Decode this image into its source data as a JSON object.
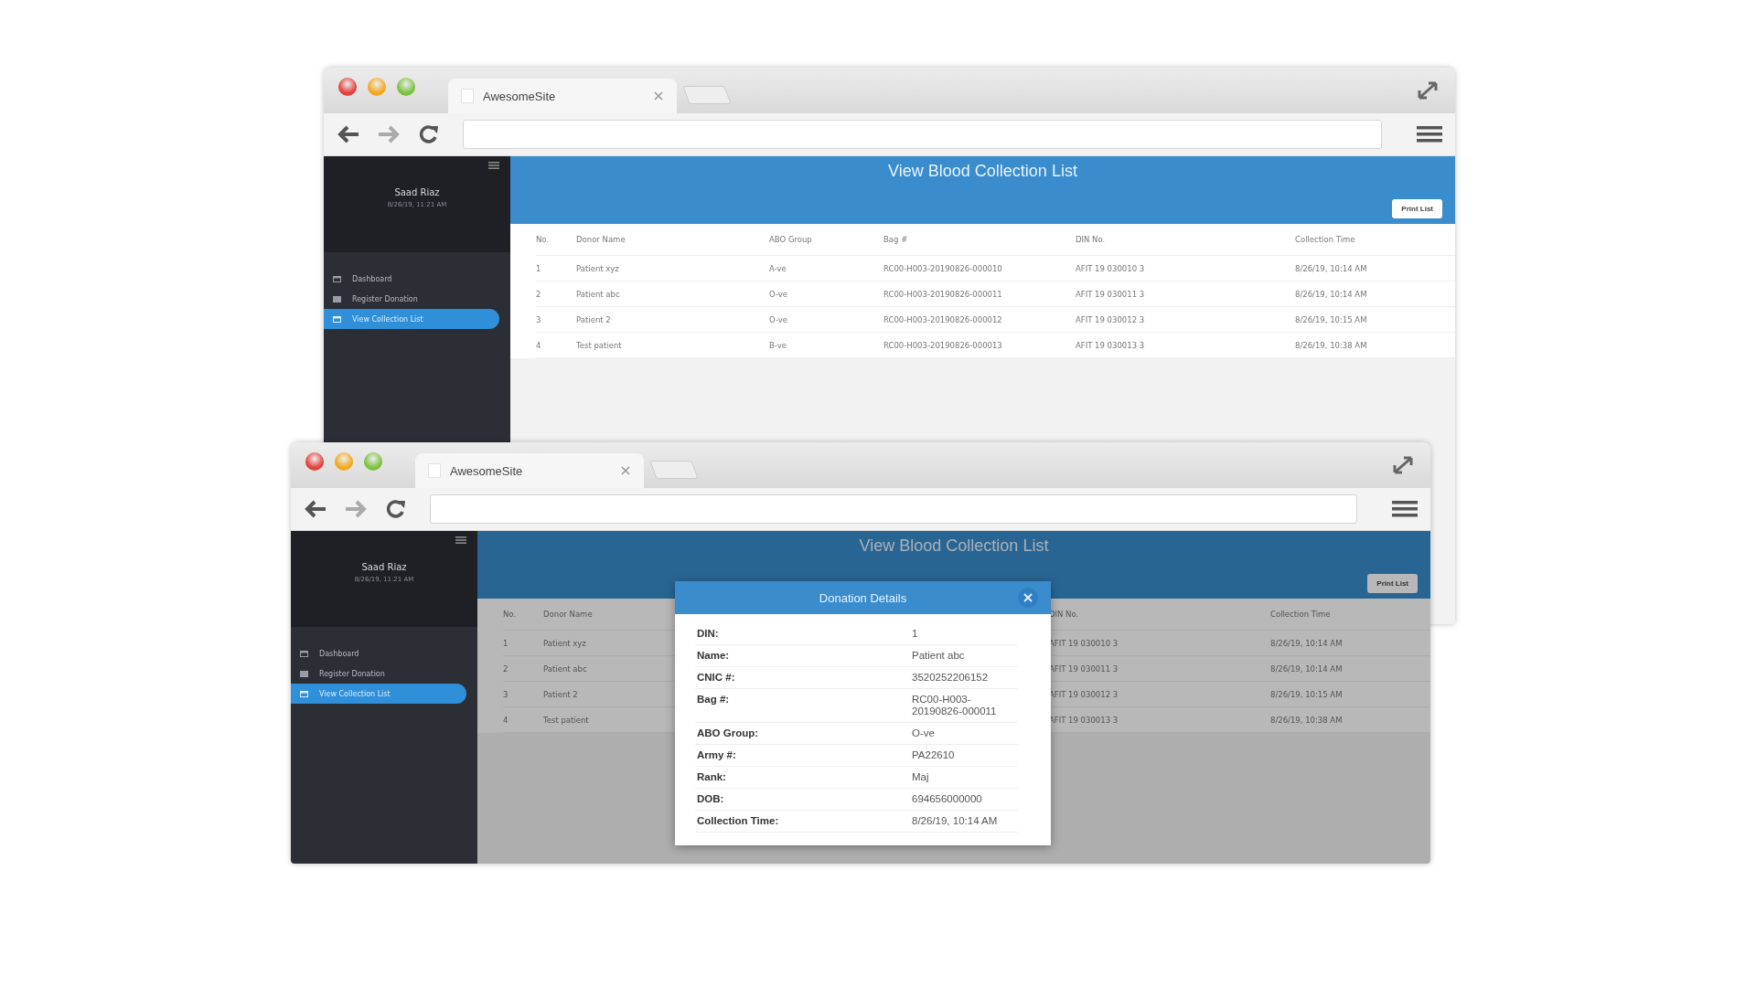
{
  "windows": [
    {
      "tab_title": "AwesomeSite",
      "page_title": "View Blood Collection List",
      "print_button": "Print List",
      "sidebar": {
        "user_name": "Saad Riaz",
        "timestamp": "8/26/19, 11:21 AM",
        "items": [
          {
            "label": "Dashboard",
            "selected": false
          },
          {
            "label": "Register Donation",
            "selected": false
          },
          {
            "label": "View Collection List",
            "selected": true
          }
        ]
      },
      "table": {
        "columns": [
          "No.",
          "Donor Name",
          "ABO Group",
          "Bag #",
          "DIN No.",
          "Collection Time"
        ],
        "rows": [
          [
            "1",
            "Patient xyz",
            "A-ve",
            "RC00-H003-20190826-000010",
            "AFIT 19 030010 3",
            "8/26/19, 10:14 AM"
          ],
          [
            "2",
            "Patient abc",
            "O-ve",
            "RC00-H003-20190826-000011",
            "AFIT 19 030011 3",
            "8/26/19, 10:14 AM"
          ],
          [
            "3",
            "Patient 2",
            "O-ve",
            "RC00-H003-20190826-000012",
            "AFIT 19 030012 3",
            "8/26/19, 10:15 AM"
          ],
          [
            "4",
            "Test patient",
            "B-ve",
            "RC00-H003-20190826-000013",
            "AFIT 19 030013 3",
            "8/26/19, 10:38 AM"
          ]
        ]
      }
    },
    {
      "tab_title": "AwesomeSite",
      "page_title": "View Blood Collection List",
      "print_button": "Print List",
      "sidebar": {
        "user_name": "Saad Riaz",
        "timestamp": "8/26/19, 11:21 AM",
        "items": [
          {
            "label": "Dashboard",
            "selected": false
          },
          {
            "label": "Register Donation",
            "selected": false
          },
          {
            "label": "View Collection List",
            "selected": true
          }
        ]
      },
      "table": {
        "columns": [
          "No.",
          "Donor Name",
          "DIN No.",
          "Collection Time"
        ],
        "rows": [
          [
            "1",
            "Patient xyz",
            "AFIT 19 030010 3",
            "8/26/19, 10:14 AM"
          ],
          [
            "2",
            "Patient abc",
            "AFIT 19 030011 3",
            "8/26/19, 10:14 AM"
          ],
          [
            "3",
            "Patient 2",
            "AFIT 19 030012 3",
            "8/26/19, 10:15 AM"
          ],
          [
            "4",
            "Test patient",
            "AFIT 19 030013 3",
            "8/26/19, 10:38 AM"
          ]
        ]
      },
      "modal": {
        "title": "Donation Details",
        "fields": [
          {
            "label": "DIN:",
            "value": "1"
          },
          {
            "label": "Name:",
            "value": "Patient abc"
          },
          {
            "label": "CNIC #:",
            "value": "3520252206152"
          },
          {
            "label": "Bag #:",
            "value": "RC00-H003-20190826-000011"
          },
          {
            "label": "ABO Group:",
            "value": "O-ve"
          },
          {
            "label": "Army #:",
            "value": "PA22610"
          },
          {
            "label": "Rank:",
            "value": "Maj"
          },
          {
            "label": "DOB:",
            "value": "694656000000"
          },
          {
            "label": "Collection Time:",
            "value": "8/26/19, 10:14 AM"
          }
        ]
      }
    }
  ]
}
